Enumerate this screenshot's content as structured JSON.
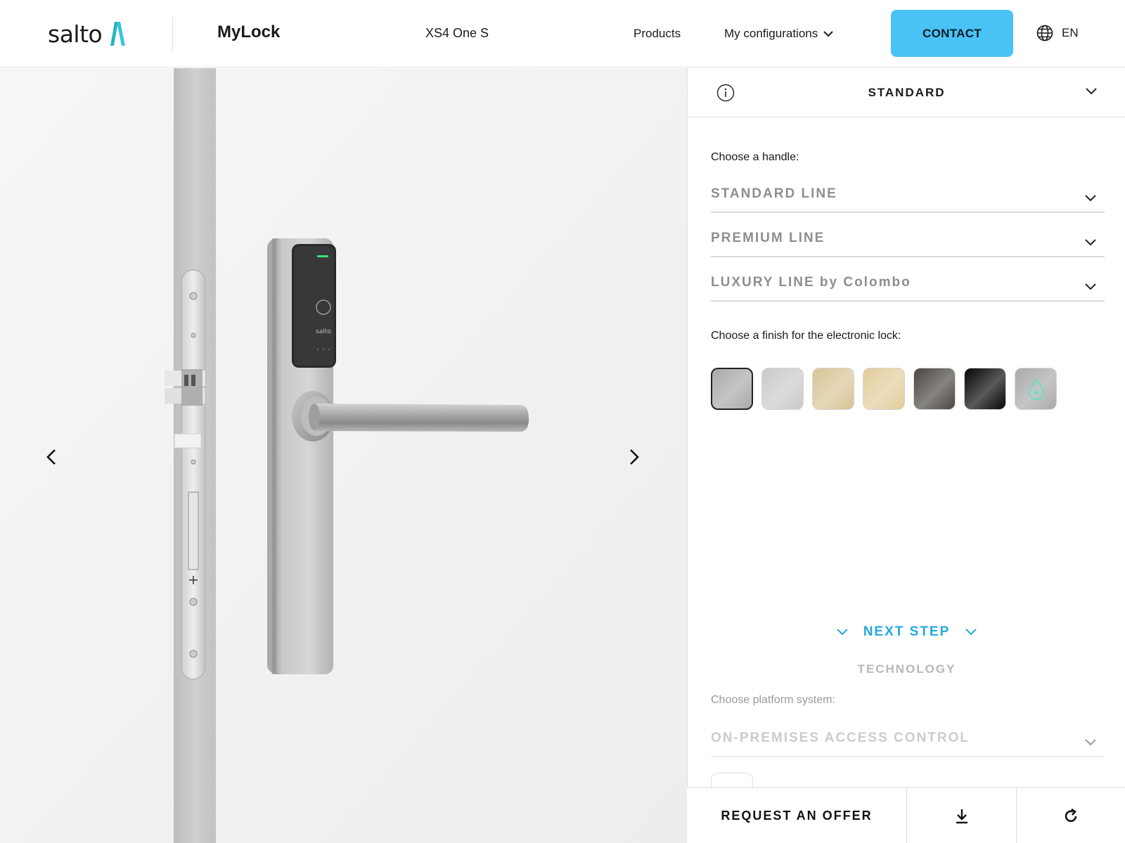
{
  "header": {
    "logo_text": "salto",
    "brand": "MyLock",
    "model": "XS4 One S",
    "nav": {
      "products": "Products",
      "configurations": "My configurations"
    },
    "contact_label": "CONTACT",
    "language": "EN"
  },
  "viewer": {
    "reader_brand": "salto"
  },
  "panel": {
    "title": "STANDARD",
    "handle_label": "Choose a handle:",
    "handle_options": [
      "STANDARD LINE",
      "PREMIUM LINE",
      "LUXURY LINE by Colombo"
    ],
    "finish_label": "Choose a finish for the electronic lock:",
    "finishes": [
      {
        "name": "satin-chrome-swatch",
        "color": "#a8a8a8",
        "selected": true
      },
      {
        "name": "polished-chrome-swatch",
        "color": "#c9c9c9",
        "selected": false
      },
      {
        "name": "satin-brass-swatch",
        "color": "#d8c394",
        "selected": false
      },
      {
        "name": "polished-brass-swatch",
        "color": "#e2cc9a",
        "selected": false
      },
      {
        "name": "dark-bronze-swatch",
        "color": "#4a4642",
        "selected": false
      },
      {
        "name": "black-swatch",
        "color": "#050505",
        "selected": false
      },
      {
        "name": "antibacterial-swatch",
        "color": "#a9a9a9",
        "selected": false
      }
    ],
    "next_step": "NEXT STEP",
    "next_section": "TECHNOLOGY",
    "platform_label": "Choose platform system:",
    "platform_option": "ON-PREMISES ACCESS CONTROL"
  },
  "bottom": {
    "request_label": "REQUEST AN OFFER"
  },
  "colors": {
    "accent": "#49c2f6",
    "next_step": "#24a9de"
  }
}
